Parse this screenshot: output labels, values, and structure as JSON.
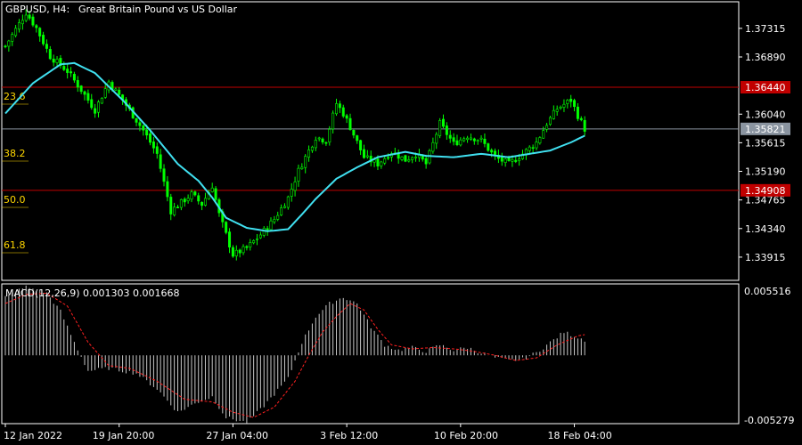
{
  "header": {
    "symbol": "GBPUSD, H4:",
    "description": "Great Britain Pound vs US Dollar"
  },
  "price_axis": {
    "ticks": [
      "1.37315",
      "1.36890",
      "1.36040",
      "1.35615",
      "1.35190",
      "1.34765",
      "1.34340",
      "1.33915"
    ],
    "range": [
      1.3357,
      1.3771
    ]
  },
  "levels": [
    {
      "value": 1.3644,
      "label": "1.36440",
      "color": "#c00000",
      "type": "horizontal-line"
    },
    {
      "value": 1.34908,
      "label": "1.34908",
      "color": "#c00000",
      "type": "horizontal-line"
    },
    {
      "value": 1.35821,
      "label": "1.35821",
      "color": "#8a94a0",
      "type": "bid-line"
    }
  ],
  "fibonacci": [
    "23.6",
    "38.2",
    "50.0",
    "61.8"
  ],
  "macd": {
    "label": "MACD(12,26,9) 0.001303 0.001668",
    "ticks": [
      "0.005516",
      "-0.005279"
    ],
    "range": [
      -0.005279,
      0.005516
    ]
  },
  "time_axis": [
    "12 Jan 2022",
    "19 Jan 20:00",
    "27 Jan 04:00",
    "3 Feb 12:00",
    "10 Feb 20:00",
    "18 Feb 04:00"
  ],
  "colors": {
    "bullish": "#00ff00",
    "bearish": "#00ff00",
    "ma": "#40e0f0",
    "histogram": "#c8c8c8",
    "signal": "#ff2020",
    "fib": "#ffd700",
    "grid": "#ffffff"
  },
  "chart_data": {
    "type": "candlestick",
    "symbol": "GBPUSD",
    "timeframe": "H4",
    "anchors": [
      [
        0,
        1.3705
      ],
      [
        6,
        1.3755
      ],
      [
        9,
        1.3732
      ],
      [
        13,
        1.369
      ],
      [
        18,
        1.3668
      ],
      [
        22,
        1.364
      ],
      [
        26,
        1.361
      ],
      [
        30,
        1.3652
      ],
      [
        34,
        1.3625
      ],
      [
        40,
        1.358
      ],
      [
        44,
        1.3545
      ],
      [
        48,
        1.346
      ],
      [
        54,
        1.3485
      ],
      [
        57,
        1.347
      ],
      [
        60,
        1.3498
      ],
      [
        62,
        1.3455
      ],
      [
        66,
        1.3395
      ],
      [
        70,
        1.3405
      ],
      [
        74,
        1.3425
      ],
      [
        78,
        1.3448
      ],
      [
        82,
        1.348
      ],
      [
        85,
        1.352
      ],
      [
        90,
        1.357
      ],
      [
        93,
        1.3565
      ],
      [
        96,
        1.362
      ],
      [
        98,
        1.3605
      ],
      [
        100,
        1.3585
      ],
      [
        104,
        1.354
      ],
      [
        108,
        1.353
      ],
      [
        112,
        1.3548
      ],
      [
        116,
        1.3536
      ],
      [
        119,
        1.3545
      ],
      [
        122,
        1.353
      ],
      [
        126,
        1.359
      ],
      [
        130,
        1.356
      ],
      [
        134,
        1.3572
      ],
      [
        138,
        1.3565
      ],
      [
        142,
        1.354
      ],
      [
        146,
        1.353
      ],
      [
        150,
        1.3545
      ],
      [
        154,
        1.3562
      ],
      [
        157,
        1.359
      ],
      [
        160,
        1.3612
      ],
      [
        164,
        1.3625
      ],
      [
        166,
        1.3602
      ],
      [
        168,
        1.3582
      ]
    ],
    "ma": [
      [
        0,
        1.3605
      ],
      [
        8,
        1.365
      ],
      [
        16,
        1.3678
      ],
      [
        20,
        1.368
      ],
      [
        26,
        1.3665
      ],
      [
        34,
        1.3625
      ],
      [
        42,
        1.358
      ],
      [
        50,
        1.353
      ],
      [
        56,
        1.3505
      ],
      [
        60,
        1.348
      ],
      [
        64,
        1.345
      ],
      [
        70,
        1.3435
      ],
      [
        76,
        1.343
      ],
      [
        82,
        1.3433
      ],
      [
        86,
        1.3455
      ],
      [
        90,
        1.3478
      ],
      [
        96,
        1.3508
      ],
      [
        102,
        1.3525
      ],
      [
        108,
        1.354
      ],
      [
        116,
        1.3548
      ],
      [
        122,
        1.3542
      ],
      [
        130,
        1.354
      ],
      [
        138,
        1.3545
      ],
      [
        146,
        1.354
      ],
      [
        152,
        1.3545
      ],
      [
        158,
        1.355
      ],
      [
        164,
        1.3562
      ],
      [
        168,
        1.3572
      ]
    ],
    "macd_hist": [
      [
        0,
        0.0045
      ],
      [
        6,
        0.0053
      ],
      [
        12,
        0.0048
      ],
      [
        16,
        0.0034
      ],
      [
        20,
        0.001
      ],
      [
        24,
        -0.0012
      ],
      [
        30,
        -0.001
      ],
      [
        38,
        -0.0014
      ],
      [
        44,
        -0.0026
      ],
      [
        50,
        -0.0044
      ],
      [
        56,
        -0.0036
      ],
      [
        60,
        -0.0032
      ],
      [
        64,
        -0.0048
      ],
      [
        70,
        -0.0052
      ],
      [
        74,
        -0.0042
      ],
      [
        78,
        -0.003
      ],
      [
        82,
        -0.0018
      ],
      [
        86,
        0.001
      ],
      [
        90,
        0.003
      ],
      [
        94,
        0.004
      ],
      [
        98,
        0.0045
      ],
      [
        102,
        0.004
      ],
      [
        106,
        0.0022
      ],
      [
        110,
        0.0008
      ],
      [
        114,
        0.0004
      ],
      [
        118,
        0.0006
      ],
      [
        122,
        0.0003
      ],
      [
        126,
        0.0008
      ],
      [
        130,
        0.0004
      ],
      [
        134,
        0.0006
      ],
      [
        138,
        0.0002
      ],
      [
        142,
        -0.0002
      ],
      [
        146,
        -0.0004
      ],
      [
        150,
        -0.0003
      ],
      [
        154,
        0.0002
      ],
      [
        158,
        0.001
      ],
      [
        162,
        0.0018
      ],
      [
        166,
        0.0014
      ],
      [
        168,
        0.0012
      ]
    ],
    "macd_signal": [
      [
        0,
        0.004
      ],
      [
        6,
        0.0047
      ],
      [
        12,
        0.0048
      ],
      [
        18,
        0.0038
      ],
      [
        24,
        0.001
      ],
      [
        30,
        -0.0008
      ],
      [
        36,
        -0.001
      ],
      [
        44,
        -0.002
      ],
      [
        52,
        -0.0034
      ],
      [
        60,
        -0.0036
      ],
      [
        66,
        -0.0044
      ],
      [
        72,
        -0.0048
      ],
      [
        78,
        -0.004
      ],
      [
        84,
        -0.002
      ],
      [
        88,
        0.0
      ],
      [
        92,
        0.0018
      ],
      [
        96,
        0.003
      ],
      [
        100,
        0.004
      ],
      [
        104,
        0.0035
      ],
      [
        108,
        0.002
      ],
      [
        112,
        0.0008
      ],
      [
        118,
        0.0005
      ],
      [
        124,
        0.0006
      ],
      [
        130,
        0.0005
      ],
      [
        136,
        0.0003
      ],
      [
        142,
        0.0
      ],
      [
        148,
        -0.0004
      ],
      [
        154,
        -0.0002
      ],
      [
        160,
        0.0008
      ],
      [
        166,
        0.0015
      ],
      [
        168,
        0.0016
      ]
    ]
  }
}
